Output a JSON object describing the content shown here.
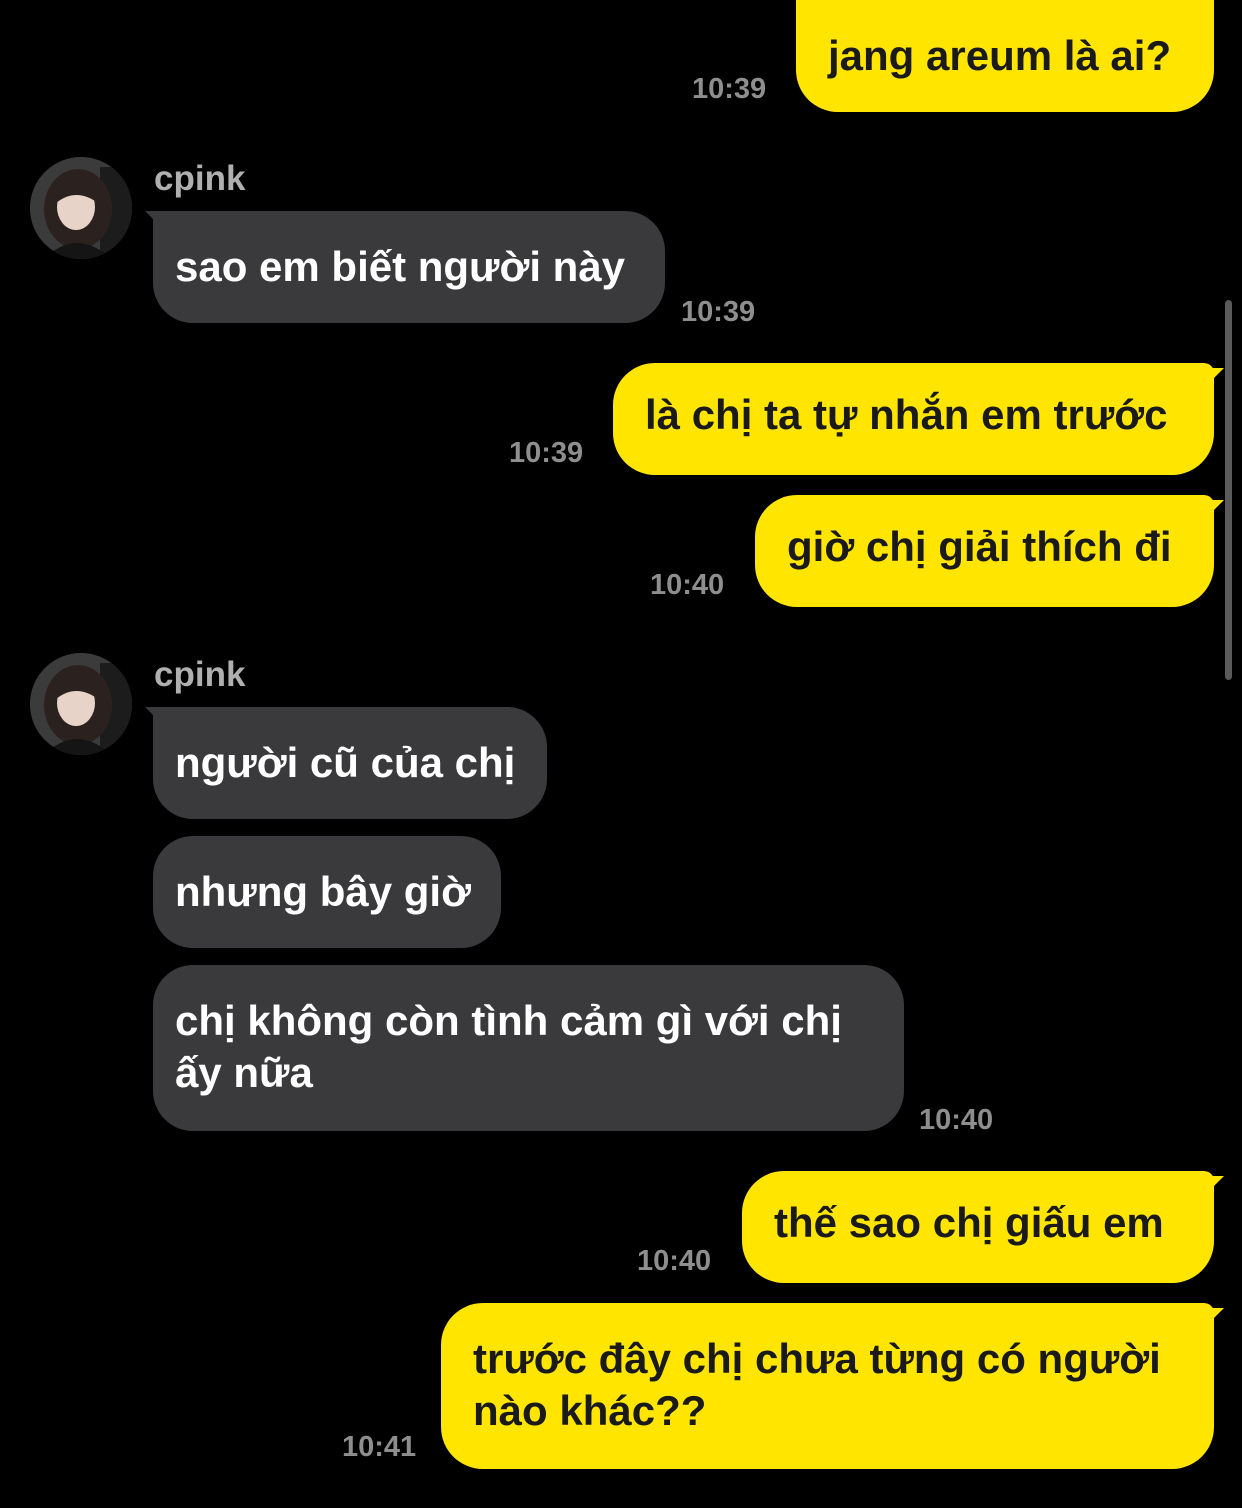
{
  "contact": {
    "name": "cpink"
  },
  "colors": {
    "outgoing_bubble": "#FFE500",
    "incoming_bubble": "#3a3a3c",
    "background": "#000000",
    "timestamp": "#8e8e8e"
  },
  "messages": [
    {
      "id": "m1",
      "from": "me",
      "text": "jang areum là ai?",
      "time": "10:39"
    },
    {
      "id": "m2",
      "from": "cpink",
      "text": "sao em biết người này",
      "time": "10:39"
    },
    {
      "id": "m3",
      "from": "me",
      "text": "là chị ta tự nhắn em trước",
      "time": "10:39"
    },
    {
      "id": "m4",
      "from": "me",
      "text": "giờ chị giải thích đi",
      "time": "10:40"
    },
    {
      "id": "m5",
      "from": "cpink",
      "text": "người cũ của chị",
      "time": ""
    },
    {
      "id": "m6",
      "from": "cpink",
      "text": "nhưng bây giờ",
      "time": ""
    },
    {
      "id": "m7",
      "from": "cpink",
      "text_line1": "chị không còn tình cảm gì với chị",
      "text_line2": "ấy nữa",
      "time": "10:40"
    },
    {
      "id": "m8",
      "from": "me",
      "text": "thế sao chị giấu em",
      "time": "10:40"
    },
    {
      "id": "m9",
      "from": "me",
      "text_line1": "trước đây chị chưa từng có người",
      "text_line2": "nào khác??",
      "time": "10:41"
    }
  ]
}
